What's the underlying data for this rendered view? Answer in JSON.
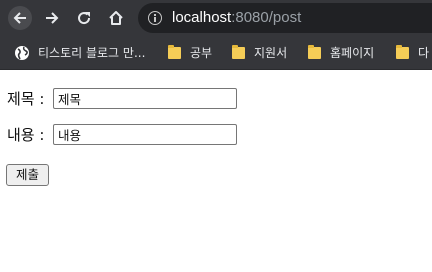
{
  "browser": {
    "url_host": "localhost",
    "url_rest": ":8080/post",
    "bookmarks": [
      {
        "label": "티스토리 블로그 만...",
        "icon": "globe-icon"
      },
      {
        "label": "공부",
        "icon": "folder-icon"
      },
      {
        "label": "지원서",
        "icon": "folder-icon"
      },
      {
        "label": "홈페이지",
        "icon": "folder-icon"
      },
      {
        "label": "다",
        "icon": "folder-icon"
      }
    ]
  },
  "form": {
    "title_label": "제목 :",
    "title_value": "제목",
    "body_label": "내용 :",
    "body_value": "내용",
    "submit_label": "제출"
  }
}
